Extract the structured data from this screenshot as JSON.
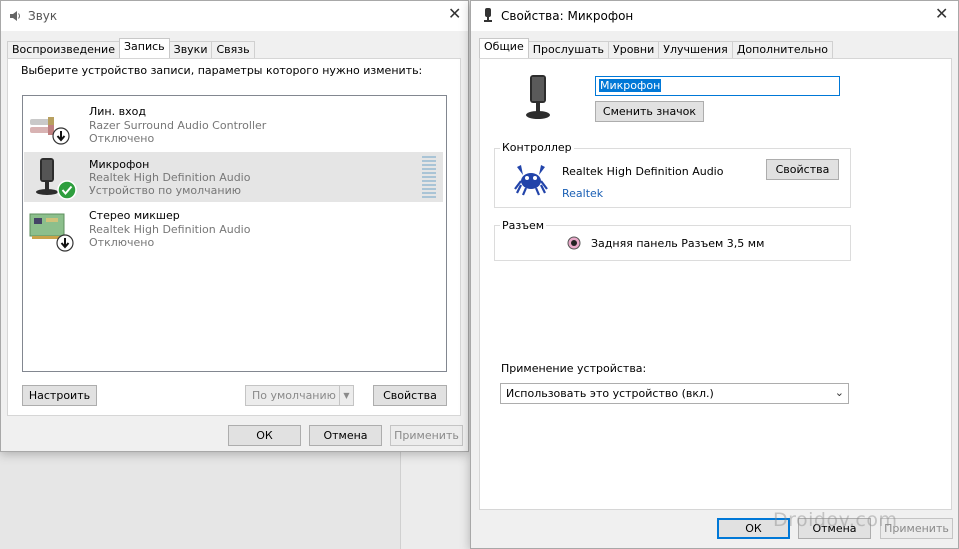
{
  "sound_window": {
    "title": "Звук",
    "tabs": [
      "Воспроизведение",
      "Запись",
      "Звуки",
      "Связь"
    ],
    "active_tab": "Запись",
    "instruction": "Выберите устройство записи, параметры которого нужно изменить:",
    "devices": [
      {
        "name": "Лин. вход",
        "driver": "Razer Surround Audio Controller",
        "status": "Отключено",
        "status_icon": "down-arrow-icon"
      },
      {
        "name": "Микрофон",
        "driver": "Realtek High Definition Audio",
        "status": "Устройство по умолчанию",
        "status_icon": "check-icon",
        "selected": true
      },
      {
        "name": "Стерео микшер",
        "driver": "Realtek High Definition Audio",
        "status": "Отключено",
        "status_icon": "down-arrow-icon"
      }
    ],
    "configure_label": "Настроить",
    "default_label": "По умолчанию",
    "properties_label": "Свойства",
    "ok_label": "ОК",
    "cancel_label": "Отмена",
    "apply_label": "Применить"
  },
  "props_window": {
    "title": "Свойства: Микрофон",
    "tabs": [
      "Общие",
      "Прослушать",
      "Уровни",
      "Улучшения",
      "Дополнительно"
    ],
    "active_tab": "Общие",
    "device_name_value": "Микрофон",
    "change_icon_label": "Сменить значок",
    "controller_label": "Контроллер",
    "controller_name": "Realtek High Definition Audio",
    "controller_link": "Realtek",
    "controller_props_label": "Свойства",
    "jack_label": "Разъем",
    "jack_value": "Задняя панель Разъем 3,5 мм",
    "usage_label": "Применение устройства:",
    "usage_value": "Использовать это устройство (вкл.)",
    "ok_label": "ОК",
    "cancel_label": "Отмена",
    "apply_label": "Применить"
  },
  "watermark": "Droidov.com",
  "colors": {
    "selection": "#e5e5e5",
    "accent": "#0078d7",
    "check_green": "#2e9e3e",
    "link": "#1a5fb4"
  }
}
